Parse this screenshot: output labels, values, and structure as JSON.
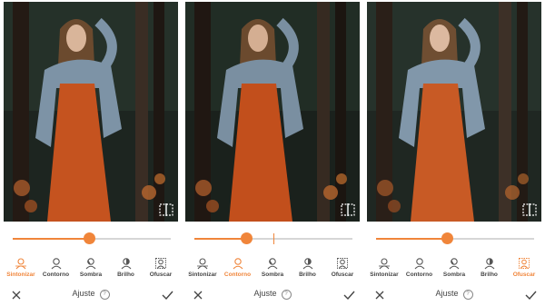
{
  "panels": [
    {
      "slider": {
        "value": 0.48,
        "center_mark": false
      },
      "active_tool": 0,
      "tools": [
        {
          "label": "Sintonizar",
          "icon": "tune-icon"
        },
        {
          "label": "Contorno",
          "icon": "contour-icon"
        },
        {
          "label": "Sombra",
          "icon": "shadow-icon"
        },
        {
          "label": "Brilho",
          "icon": "brightness-icon"
        },
        {
          "label": "Ofuscar",
          "icon": "blur-icon"
        }
      ],
      "title": "Ajuste",
      "help": "?"
    },
    {
      "slider": {
        "value": 0.33,
        "center_mark": true
      },
      "active_tool": 1,
      "tools": [
        {
          "label": "Sintonizar",
          "icon": "tune-icon"
        },
        {
          "label": "Contorno",
          "icon": "contour-icon"
        },
        {
          "label": "Sombra",
          "icon": "shadow-icon"
        },
        {
          "label": "Brilho",
          "icon": "brightness-icon"
        },
        {
          "label": "Ofuscar",
          "icon": "blur-icon"
        }
      ],
      "title": "Ajuste",
      "help": "?"
    },
    {
      "slider": {
        "value": 0.45,
        "center_mark": false
      },
      "active_tool": 4,
      "tools": [
        {
          "label": "Sintonizar",
          "icon": "tune-icon"
        },
        {
          "label": "Contorno",
          "icon": "contour-icon"
        },
        {
          "label": "Sombra",
          "icon": "shadow-icon"
        },
        {
          "label": "Brilho",
          "icon": "brightness-icon"
        },
        {
          "label": "Ofuscar",
          "icon": "blur-icon"
        }
      ],
      "title": "Ajuste",
      "help": "?"
    }
  ],
  "colors": {
    "accent": "#f0853a",
    "text": "#444444",
    "track": "#d6d6d6"
  }
}
